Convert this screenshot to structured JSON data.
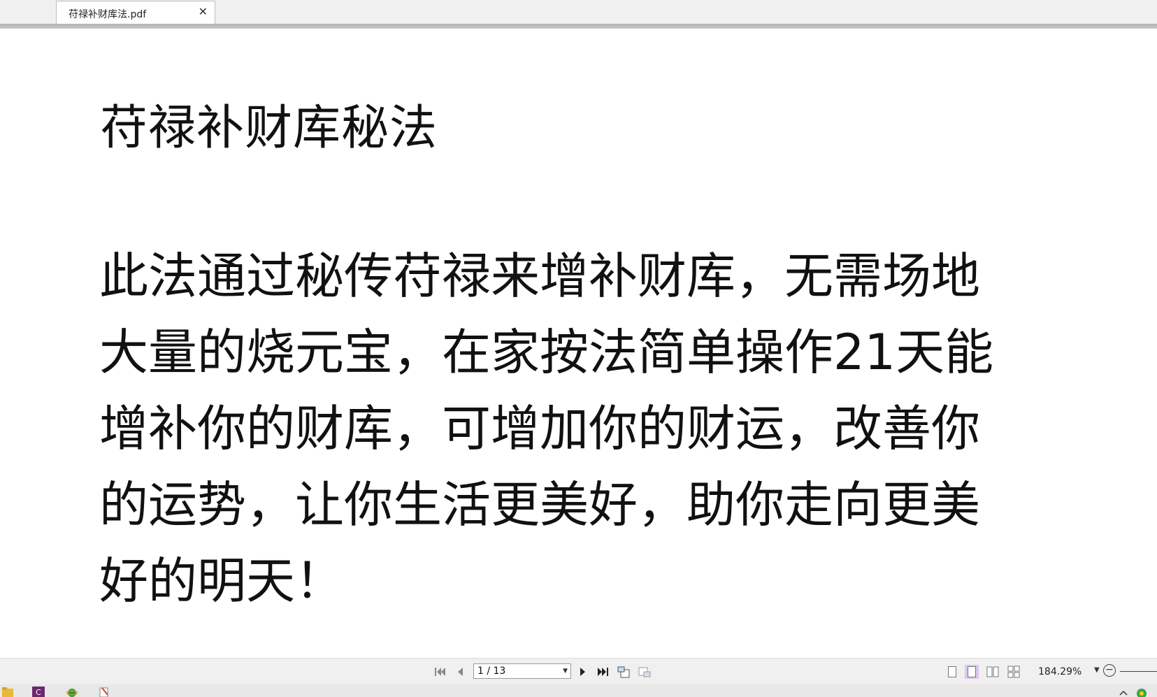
{
  "tab": {
    "title": "苻禄补财库法.pdf",
    "close_symbol": "✕"
  },
  "document": {
    "title": "苻禄补财库秘法",
    "body_lines": [
      "此法通过秘传苻禄来增补财库，无需场地",
      "大量的烧元宝，在家按法简单操作21天能",
      "增补你的财库，可增加你的财运，改善你",
      "的运势，让你生活更美好，助你走向更美",
      "好的明天！"
    ]
  },
  "navigation": {
    "page_indicator": "1 / 13",
    "first_icon": "first-page-icon",
    "prev_icon": "previous-page-icon",
    "next_icon": "next-page-icon",
    "last_icon": "last-page-icon"
  },
  "zoom": {
    "level": "184.29%"
  },
  "colors": {
    "active_view": "#dcc6f0",
    "toolbar_bg": "#f0f0f0"
  }
}
